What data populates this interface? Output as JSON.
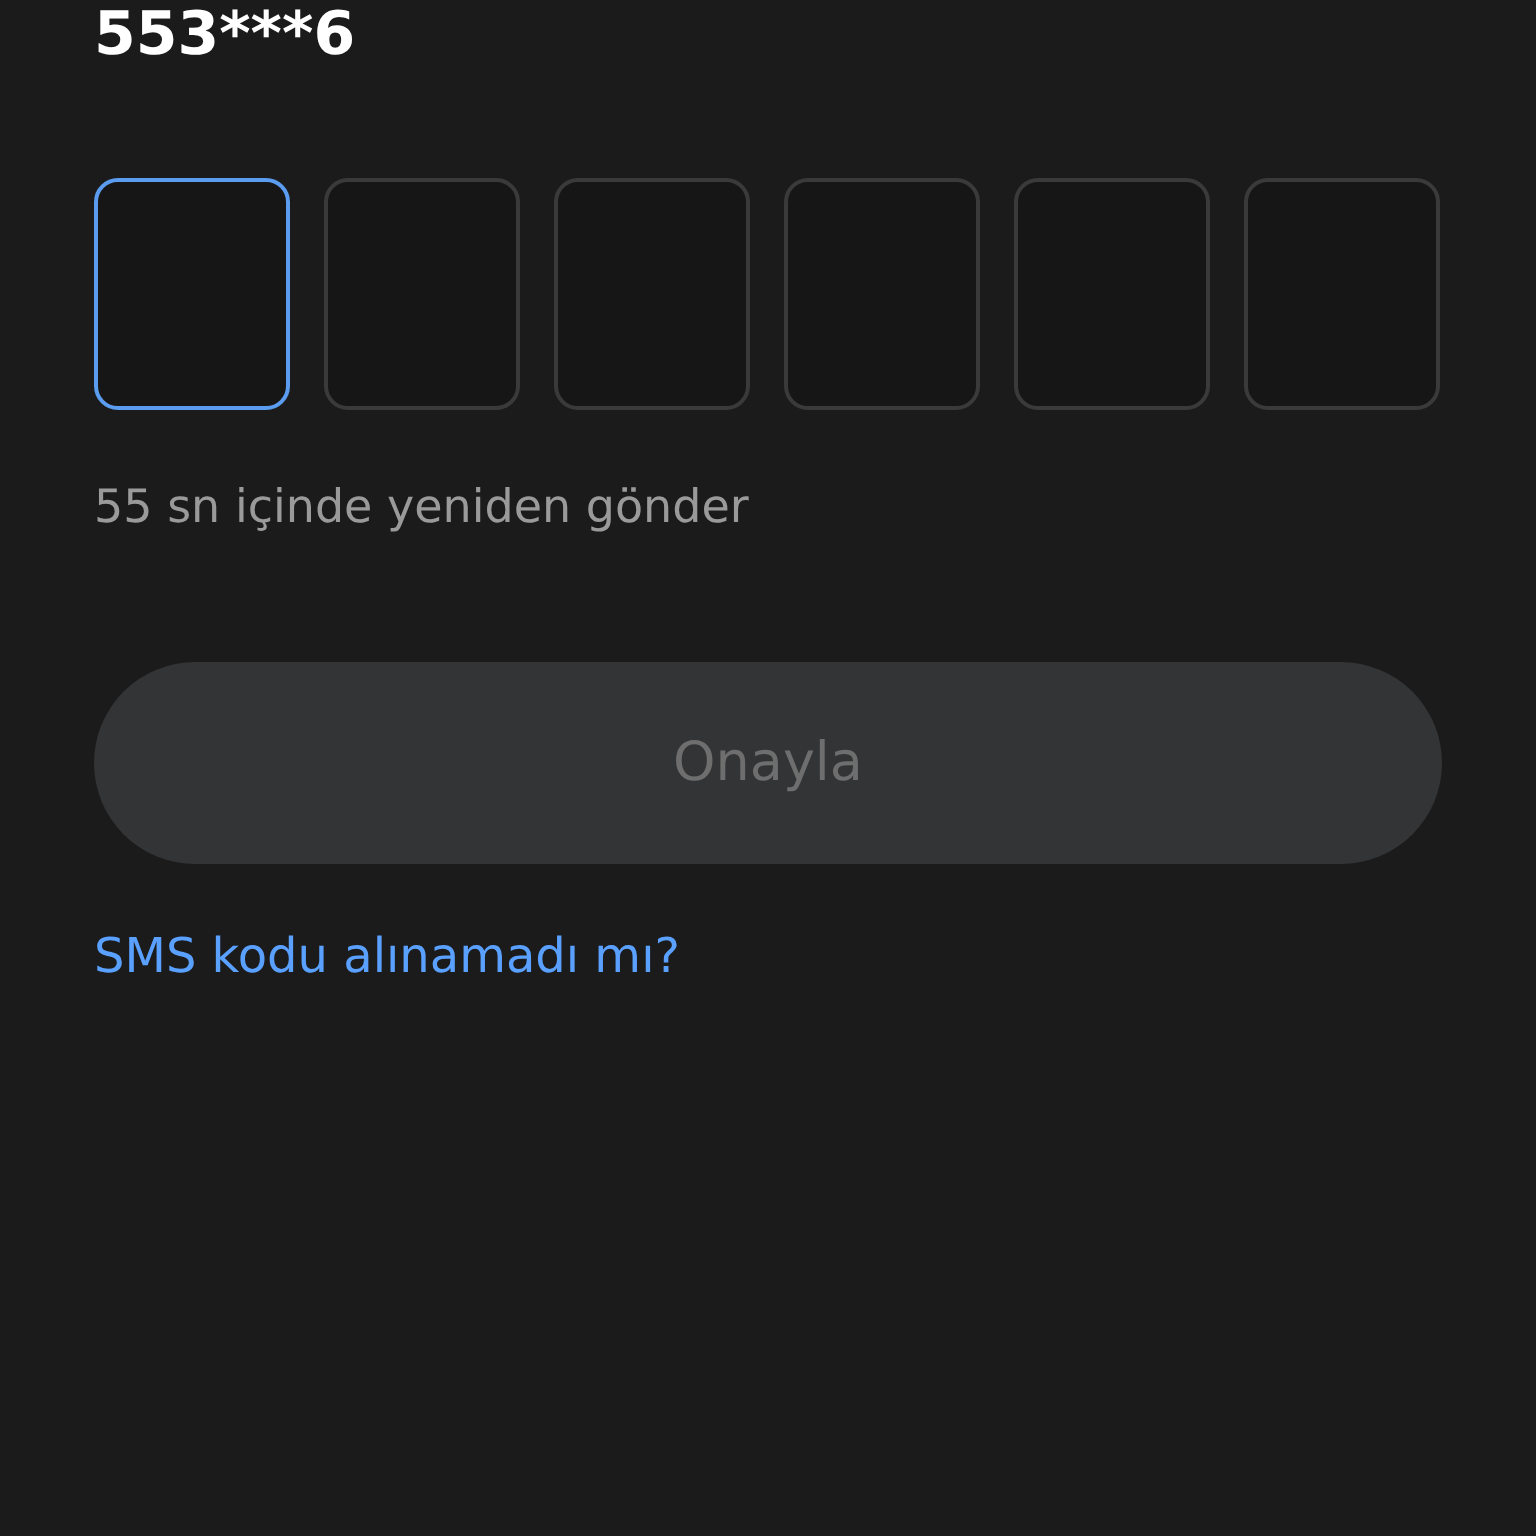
{
  "phone": "553***6",
  "code_boxes": [
    {
      "focused": true
    },
    {
      "focused": false
    },
    {
      "focused": false
    },
    {
      "focused": false
    },
    {
      "focused": false
    },
    {
      "focused": false
    }
  ],
  "resend": "55 sn içinde yeniden gönder",
  "confirm_button": {
    "label": "Onayla",
    "disabled": true
  },
  "help_link": "SMS kodu alınamadı mı?"
}
